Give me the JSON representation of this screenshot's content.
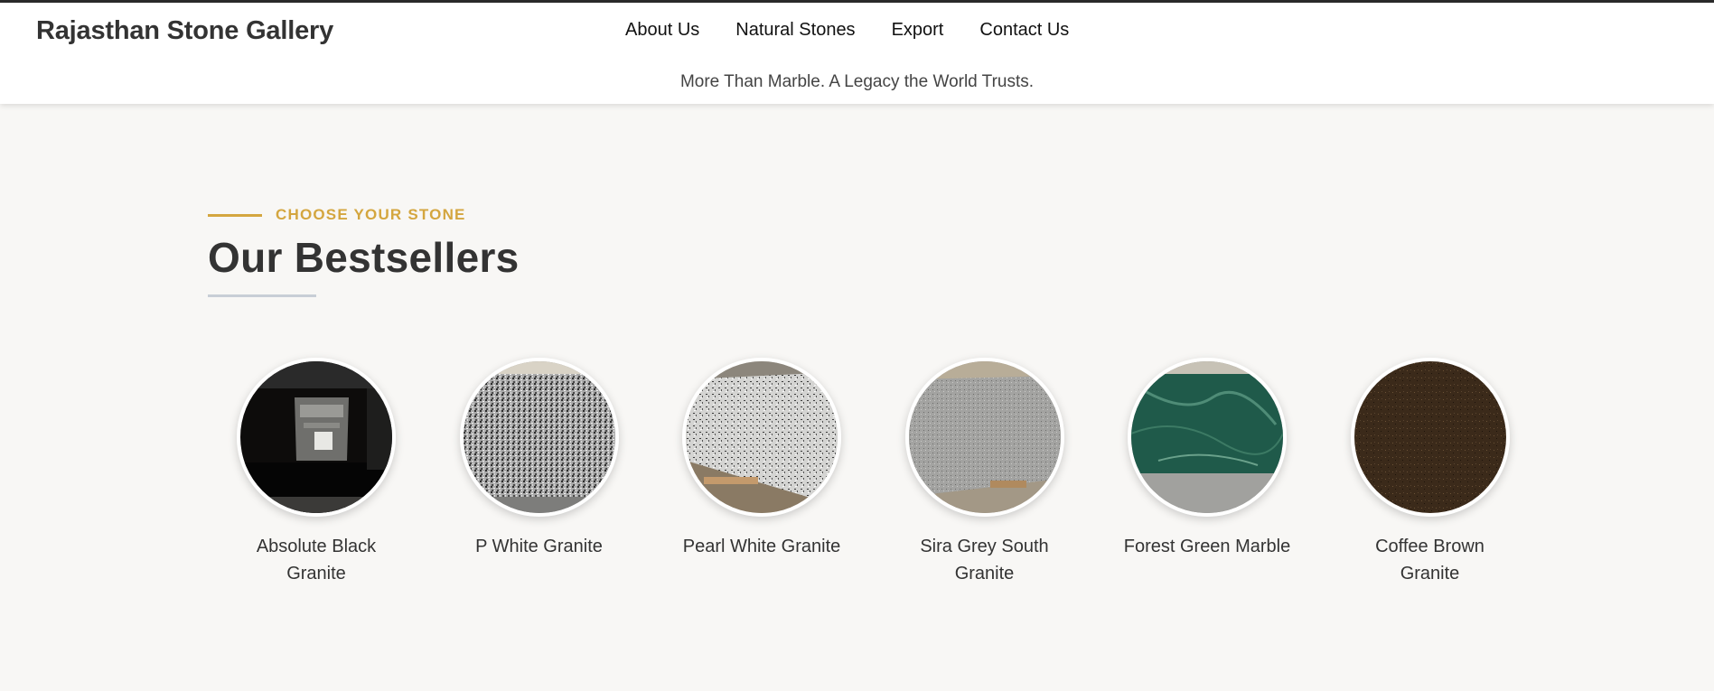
{
  "header": {
    "brand": "Rajasthan Stone Gallery",
    "nav": [
      {
        "label": "About Us"
      },
      {
        "label": "Natural Stones"
      },
      {
        "label": "Export"
      },
      {
        "label": "Contact Us"
      }
    ],
    "tagline": "More Than Marble. A Legacy the World Trusts."
  },
  "bestsellers": {
    "eyebrow": "CHOOSE YOUR STONE",
    "title": "Our Bestsellers",
    "accent_color": "#d4a63f",
    "products": [
      {
        "name": "Absolute Black Granite",
        "icon": "absolute-black-granite-image"
      },
      {
        "name": "P White Granite",
        "icon": "p-white-granite-image"
      },
      {
        "name": "Pearl White Granite",
        "icon": "pearl-white-granite-image"
      },
      {
        "name": "Sira Grey South Granite",
        "icon": "sira-grey-south-granite-image"
      },
      {
        "name": "Forest Green Marble",
        "icon": "forest-green-marble-image"
      },
      {
        "name": "Coffee Brown Granite",
        "icon": "coffee-brown-granite-image"
      }
    ]
  }
}
